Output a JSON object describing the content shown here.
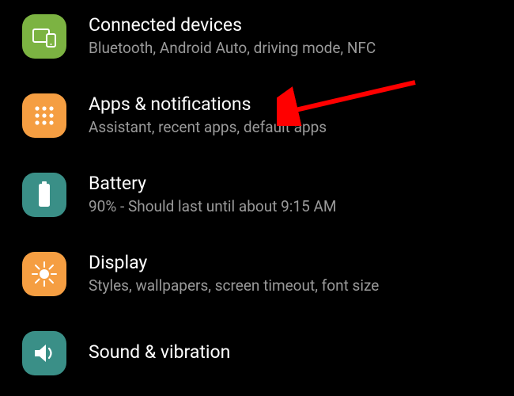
{
  "items": [
    {
      "key": "connected-devices",
      "title": "Connected devices",
      "subtitle": "Bluetooth, Android Auto, driving mode, NFC",
      "icon": "devices-icon",
      "tile_color": "#7cb342"
    },
    {
      "key": "apps-notifications",
      "title": "Apps & notifications",
      "subtitle": "Assistant, recent apps, default apps",
      "icon": "apps-grid-icon",
      "tile_color": "#f59e42"
    },
    {
      "key": "battery",
      "title": "Battery",
      "subtitle": "90% - Should last until about 9:15 AM",
      "icon": "battery-icon",
      "tile_color": "#3a8f87"
    },
    {
      "key": "display",
      "title": "Display",
      "subtitle": "Styles, wallpapers, screen timeout, font size",
      "icon": "brightness-icon",
      "tile_color": "#f59e42"
    },
    {
      "key": "sound-vibration",
      "title": "Sound & vibration",
      "subtitle": "",
      "icon": "sound-icon",
      "tile_color": "#3a8f87"
    }
  ],
  "annotation": {
    "arrow_color": "#ff0000",
    "arrow_target": "apps-notifications"
  }
}
